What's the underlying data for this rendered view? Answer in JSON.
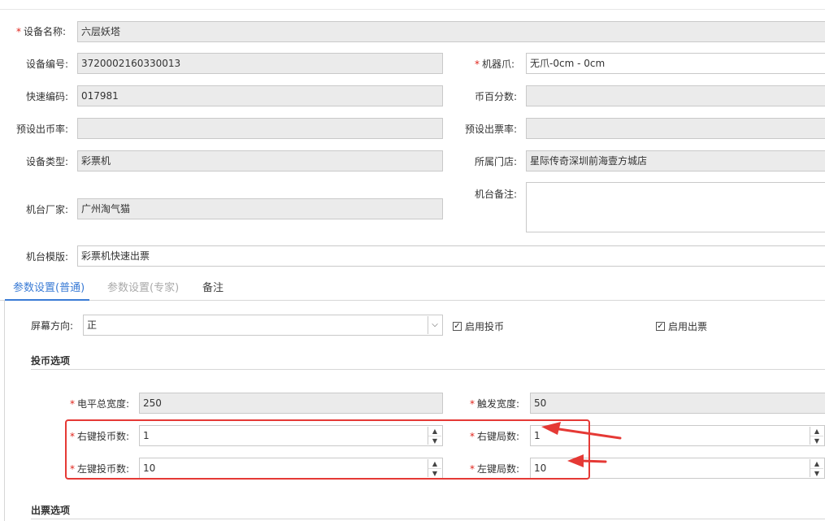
{
  "required_mark": "*",
  "device": {
    "name_label": "设备名称:",
    "name_value": "六层妖塔",
    "code_label": "设备编号:",
    "code_value": "3720002160330013",
    "claw_label": "机器爪:",
    "claw_value": "无爪-0cm - 0cm",
    "quick_code_label": "快速编码:",
    "quick_code_value": "017981",
    "coin_percent_label": "币百分数:",
    "coin_percent_value": "",
    "preset_coin_rate_label": "预设出币率:",
    "preset_coin_rate_value": "",
    "preset_ticket_rate_label": "预设出票率:",
    "preset_ticket_rate_value": "",
    "type_label": "设备类型:",
    "type_value": "彩票机",
    "store_label": "所属门店:",
    "store_value": "星际传奇深圳前海壹方城店",
    "vendor_label": "机台厂家:",
    "vendor_value": "广州淘气猫",
    "remark_label": "机台备注:",
    "remark_value": "",
    "template_label": "机台模版:",
    "template_value": "彩票机快速出票"
  },
  "tabs": [
    {
      "label": "参数设置(普通)",
      "state": "active"
    },
    {
      "label": "参数设置(专家)",
      "state": "disabled"
    },
    {
      "label": "备注",
      "state": "normal"
    }
  ],
  "params": {
    "screen_orientation_label": "屏幕方向:",
    "screen_orientation_value": "正",
    "enable_coin_label": "启用投币",
    "enable_coin_checked": true,
    "enable_ticket_label": "启用出票",
    "enable_ticket_checked": true,
    "coin_section_title": "投币选项",
    "level_total_width_label": "电平总宽度:",
    "level_total_width_value": "250",
    "trigger_width_label": "触发宽度:",
    "trigger_width_value": "50",
    "right_key_coins_label": "右键投币数:",
    "right_key_coins_value": "1",
    "right_key_rounds_label": "右键局数:",
    "right_key_rounds_value": "1",
    "left_key_coins_label": "左键投币数:",
    "left_key_coins_value": "10",
    "left_key_rounds_label": "左键局数:",
    "left_key_rounds_value": "10",
    "ticket_section_title": "出票选项"
  },
  "icons": {
    "check": "✓",
    "spin_up": "▲",
    "spin_down": "▼",
    "dropdown": "chevron-down-icon"
  },
  "annotation_color": "#e53935",
  "accent_color": "#3a7bd5"
}
